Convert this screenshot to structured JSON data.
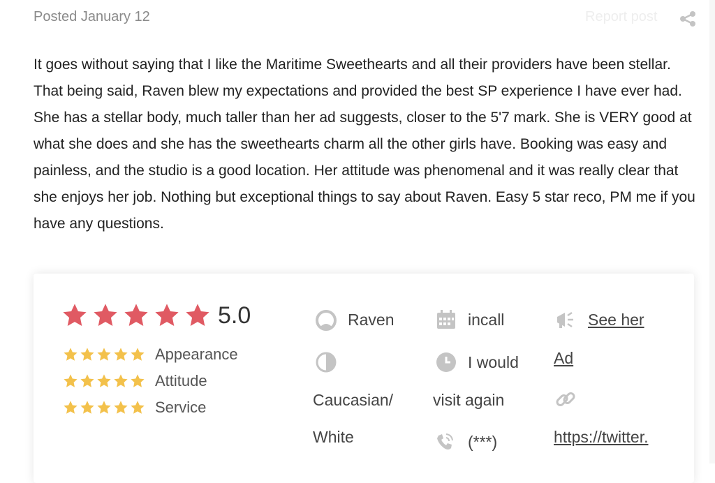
{
  "post": {
    "posted": "Posted January 12",
    "report": "Report post",
    "paragraphs": [
      "It goes without saying that I like the Maritime Sweethearts and all their providers have been stellar.  That being said, Raven blew my expectations and provided the best SP experience I have ever had.  She has a stellar body, much taller than her ad suggests, closer to the 5'7 mark.  She is VERY good at what she does and she has the sweethearts charm all the other girls have. Booking was easy and painless, and the studio is a good location.  Her attitude was phenomenal and it was really clear that she enjoys her job.  Nothing but exceptional things to say about Raven.  Easy 5 star reco,  PM me if you have any questions."
    ]
  },
  "review": {
    "overall": {
      "score": "5.0",
      "stars": 5
    },
    "categories": [
      {
        "label": "Appearance",
        "stars": 5
      },
      {
        "label": "Attitude",
        "stars": 5
      },
      {
        "label": "Service",
        "stars": 5
      }
    ],
    "provider_name": "Raven",
    "ethnicity_line1": "Caucasian/",
    "ethnicity_line2": "White",
    "location_type": "incall",
    "visit_again_line1": "I would",
    "visit_again_line2": "visit again",
    "phone": "(***)",
    "ad_link_line1": "See her",
    "ad_link_line2": "Ad",
    "twitter_link": "https://twitter."
  },
  "colors": {
    "star_big": "#e05a63",
    "star_small": "#f3c14b",
    "icon_gray": "#c4c4c4"
  },
  "icons": [
    "share-icon",
    "person-icon",
    "contrast-icon",
    "calendar-icon",
    "clock-icon",
    "phone-icon",
    "megaphone-icon",
    "link-icon",
    "star-icon"
  ]
}
